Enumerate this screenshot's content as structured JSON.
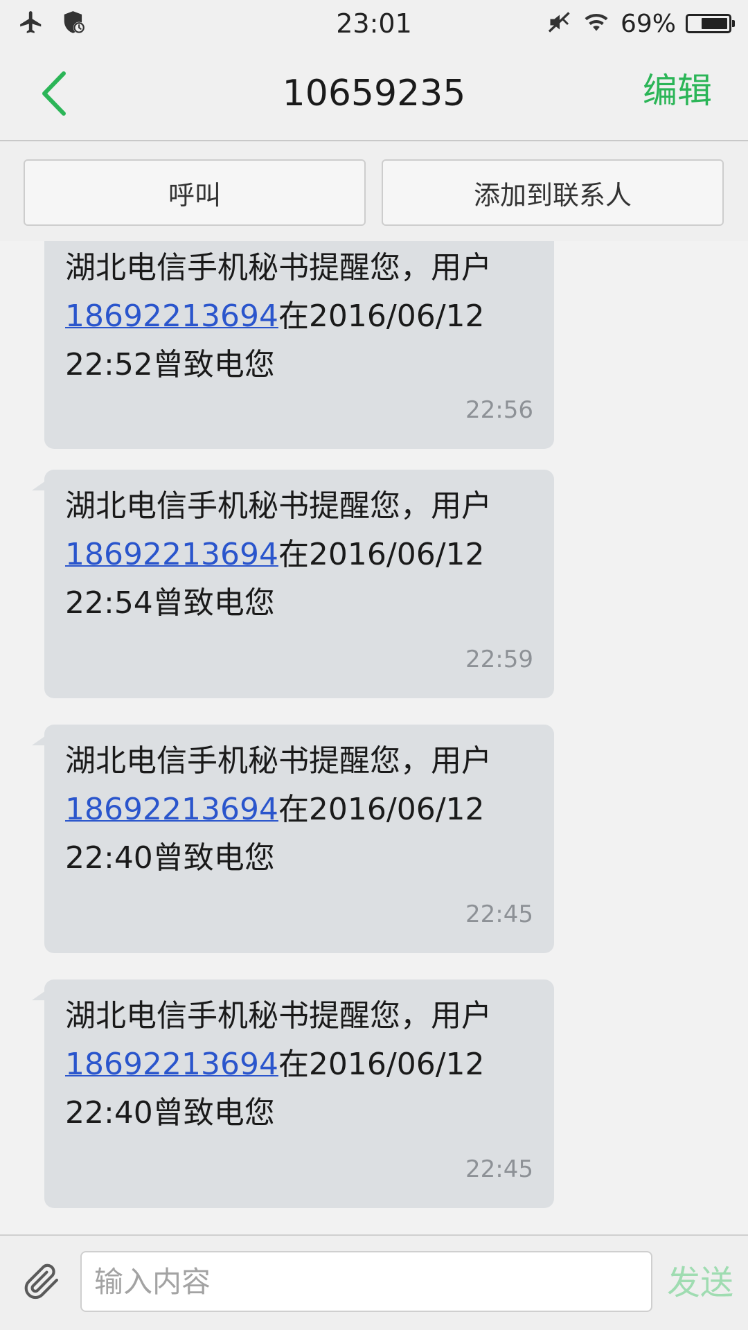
{
  "status_bar": {
    "time": "23:01",
    "battery_text": "69%",
    "battery_level": 0.69,
    "icons": [
      "airplane-icon",
      "shield-clock-icon",
      "mute-icon",
      "wifi-icon",
      "battery-icon"
    ]
  },
  "header": {
    "title": "10659235",
    "edit_label": "编辑",
    "back_icon": "chevron-left-icon",
    "accent_color": "#2bb557"
  },
  "actions": {
    "call_label": "呼叫",
    "add_contact_label": "添加到联系人"
  },
  "messages": [
    {
      "line1": "湖北电信手机秘书提醒您，用户",
      "phone": "18692213694",
      "line2_after": "在2016/06/12",
      "line3": "22:52曾致电您",
      "time": "22:56"
    },
    {
      "line1": "湖北电信手机秘书提醒您，用户",
      "phone": "18692213694",
      "line2_after": "在2016/06/12",
      "line3": "22:54曾致电您",
      "time": "22:59"
    },
    {
      "line1": "湖北电信手机秘书提醒您，用户",
      "phone": "18692213694",
      "line2_after": "在2016/06/12",
      "line3": "22:40曾致电您",
      "time": "22:45"
    },
    {
      "line1": "湖北电信手机秘书提醒您，用户",
      "phone": "18692213694",
      "line2_after": "在2016/06/12",
      "line3": "22:40曾致电您",
      "time": "22:45"
    }
  ],
  "composer": {
    "placeholder": "输入内容",
    "value": "",
    "send_label": "发送",
    "attach_icon": "paperclip-icon"
  }
}
